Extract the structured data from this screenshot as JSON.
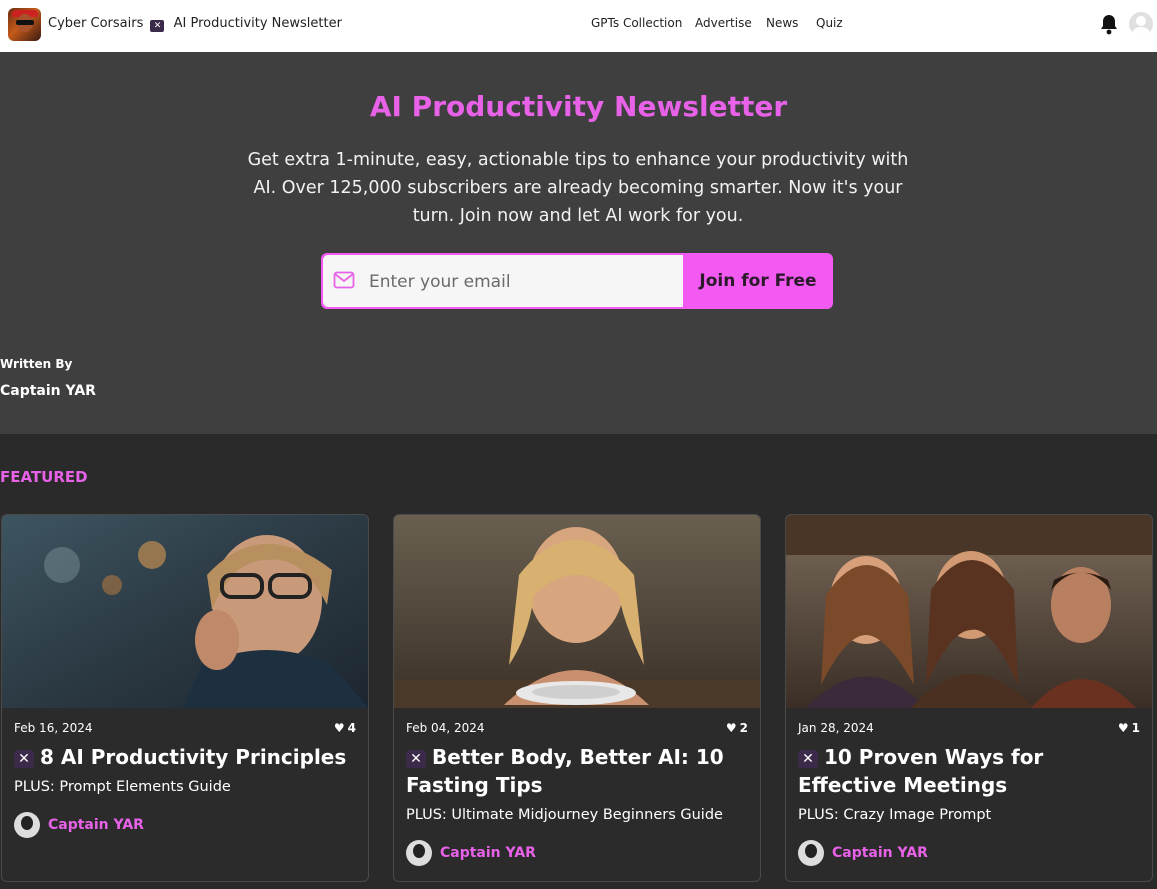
{
  "header": {
    "brand": "Cyber Corsairs",
    "brand_separator_icon": "pirate-flag-icon",
    "brand_subtitle": "AI Productivity Newsletter",
    "nav": [
      "GPTs Collection",
      "Advertise",
      "News",
      "Quiz"
    ]
  },
  "hero": {
    "title": "AI Productivity Newsletter",
    "description": "Get extra 1-minute, easy, actionable tips to enhance your productivity with AI. Over 125,000 subscribers are already becoming smarter. Now it's your turn. Join now and let AI work for you.",
    "email_placeholder": "Enter your email",
    "join_label": "Join for Free",
    "written_by_label": "Written By",
    "author": "Captain YAR"
  },
  "featured": {
    "label": "FEATURED",
    "cards": [
      {
        "date": "Feb 16, 2024",
        "likes": "4",
        "title": "8 AI Productivity Principles",
        "subtitle": "PLUS: Prompt Elements Guide",
        "author": "Captain YAR"
      },
      {
        "date": "Feb 04, 2024",
        "likes": "2",
        "title": "Better Body, Better AI: 10 Fasting Tips",
        "subtitle": "PLUS: Ultimate Midjourney Beginners Guide",
        "author": "Captain YAR"
      },
      {
        "date": "Jan 28, 2024",
        "likes": "1",
        "title": "10 Proven Ways for Effective Meetings",
        "subtitle": "PLUS: Crazy Image Prompt",
        "author": "Captain YAR"
      }
    ]
  },
  "colors": {
    "accent": "#e862e8",
    "button": "#f25af2",
    "hero_bg": "#3f3f3f",
    "page_bg": "#2a2a2a"
  }
}
